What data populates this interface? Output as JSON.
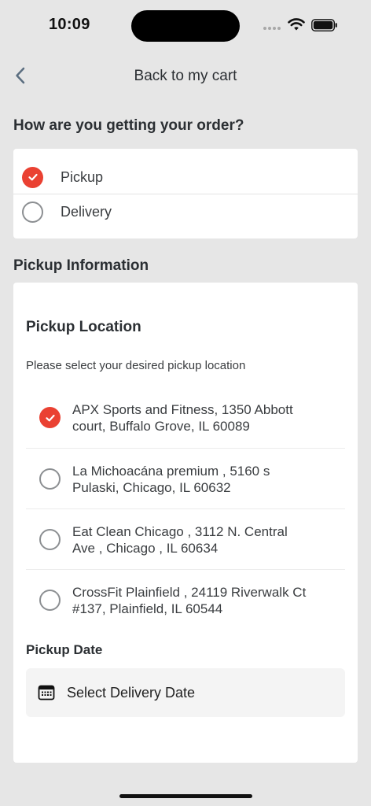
{
  "status_bar": {
    "time": "10:09"
  },
  "nav": {
    "title": "Back to my cart",
    "back_icon": "chevron-left-icon"
  },
  "delivery_method": {
    "title": "How are you getting your order?",
    "options": [
      {
        "label": "Pickup",
        "selected": true
      },
      {
        "label": "Delivery",
        "selected": false
      }
    ]
  },
  "pickup_info": {
    "title": "Pickup Information",
    "location": {
      "title": "Pickup Location",
      "description": "Please select your desired pickup location",
      "options": [
        {
          "line1": "APX Sports and Fitness, 1350 Abbott",
          "line2": "court, Buffalo Grove, IL 60089",
          "selected": true
        },
        {
          "line1": "La Michoacána premium , 5160 s",
          "line2": "Pulaski, Chicago, IL 60632",
          "selected": false
        },
        {
          "line1": "Eat Clean Chicago , 3112 N. Central",
          "line2": "Ave , Chicago , IL 60634",
          "selected": false
        },
        {
          "line1": "CrossFit Plainfield , 24119 Riverwalk Ct",
          "line2": "#137, Plainfield, IL 60544",
          "selected": false
        }
      ]
    },
    "date": {
      "title": "Pickup Date",
      "placeholder": "Select Delivery Date",
      "icon": "calendar-icon"
    }
  },
  "colors": {
    "accent": "#ea4132",
    "background": "#e6e6e6",
    "card": "#ffffff"
  }
}
